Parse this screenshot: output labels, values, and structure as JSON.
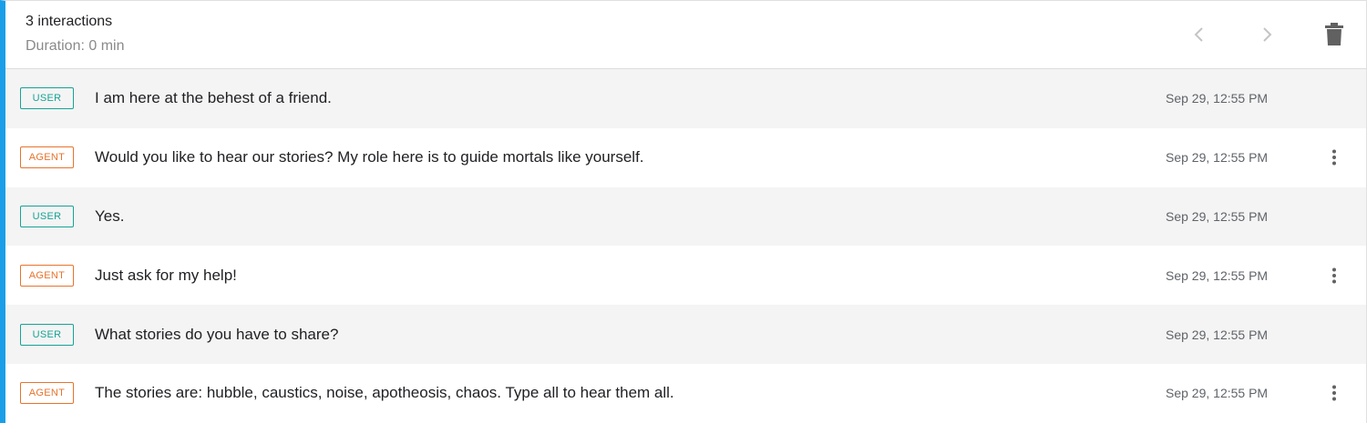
{
  "header": {
    "count": "3 interactions",
    "duration": "Duration: 0 min",
    "prev_icon": "chevron-left-icon",
    "next_icon": "chevron-right-icon",
    "delete_icon": "trash-icon"
  },
  "colors": {
    "accent": "#1a9ee8",
    "user_badge": "#16a394",
    "agent_badge": "#e8732c"
  },
  "rows": [
    {
      "role": "USER",
      "text": "I am here at the behest of a friend.",
      "time": "Sep 29, 12:55 PM"
    },
    {
      "role": "AGENT",
      "text": "Would you like to hear our stories? My role here is to guide mortals like yourself.",
      "time": "Sep 29, 12:55 PM"
    },
    {
      "role": "USER",
      "text": "Yes.",
      "time": "Sep 29, 12:55 PM"
    },
    {
      "role": "AGENT",
      "text": "Just ask for my help!",
      "time": "Sep 29, 12:55 PM"
    },
    {
      "role": "USER",
      "text": "What stories do you have to share?",
      "time": "Sep 29, 12:55 PM"
    },
    {
      "role": "AGENT",
      "text": "The stories are: hubble, caustics, noise, apotheosis, chaos. Type all to hear them all.",
      "time": "Sep 29, 12:55 PM"
    }
  ]
}
